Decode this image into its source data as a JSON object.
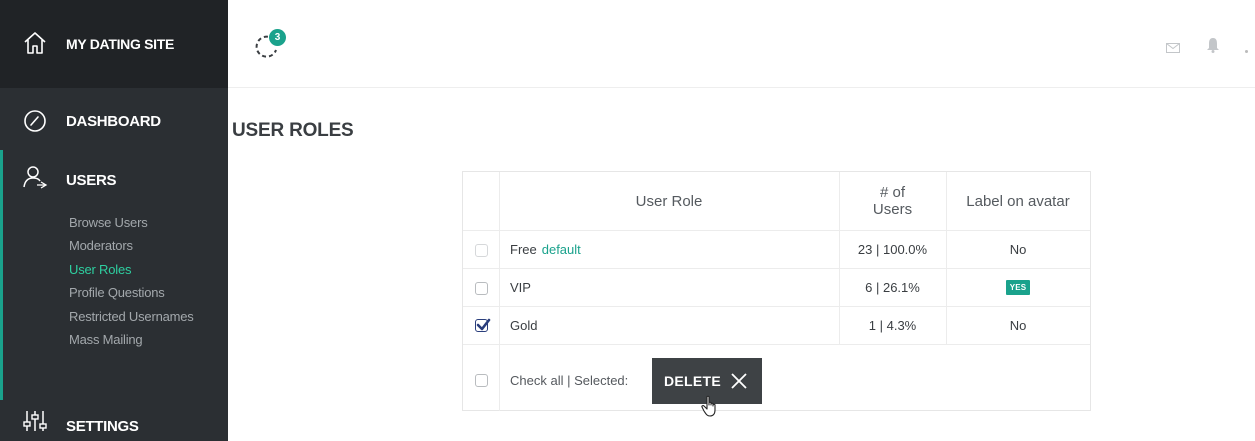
{
  "sidebar": {
    "brand": "MY DATING SITE",
    "dashboard": "DASHBOARD",
    "users": "USERS",
    "users_submenu": [
      "Browse Users",
      "Moderators",
      "User Roles",
      "Profile Questions",
      "Restricted Usernames",
      "Mass Mailing"
    ],
    "active_submenu": "User Roles",
    "settings": "SETTINGS"
  },
  "topbar": {
    "refresh_badge": "3"
  },
  "page": {
    "title": "USER ROLES"
  },
  "table": {
    "headers": {
      "role": "User Role",
      "users_line1": "# of",
      "users_line2": "Users",
      "label": "Label on avatar"
    },
    "rows": [
      {
        "name": "Free",
        "tag": "default",
        "users": "23 | 100.0%",
        "label": "No",
        "checked": false
      },
      {
        "name": "VIP",
        "tag": "",
        "users": "6 | 26.1%",
        "label": "YES",
        "checked": false
      },
      {
        "name": "Gold",
        "tag": "",
        "users": "1 | 4.3%",
        "label": "No",
        "checked": true
      }
    ],
    "footer": {
      "check_all": "Check all | Selected:",
      "delete": "DELETE"
    }
  },
  "colors": {
    "accent": "#1aa28c",
    "sidebar": "#2b2f33",
    "sidebar_brand": "#202326",
    "active_link": "#2ecfa0"
  }
}
